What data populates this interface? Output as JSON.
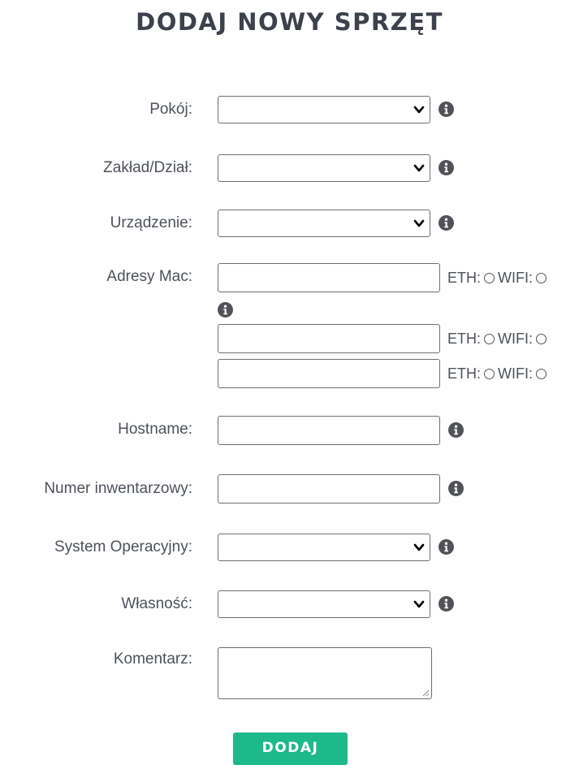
{
  "page": {
    "title": "DODAJ NOWY SPRZĘT"
  },
  "form": {
    "room": {
      "label": "Pokój:",
      "value": ""
    },
    "department": {
      "label": "Zakład/Dział:",
      "value": ""
    },
    "device": {
      "label": "Urządzenie:",
      "value": ""
    },
    "mac": {
      "label": "Adresy Mac:",
      "entries": [
        {
          "value": "",
          "eth_label": "ETH:",
          "wifi_label": "WIFI:"
        },
        {
          "value": "",
          "eth_label": "ETH:",
          "wifi_label": "WIFI:"
        },
        {
          "value": "",
          "eth_label": "ETH:",
          "wifi_label": "WIFI:"
        }
      ]
    },
    "hostname": {
      "label": "Hostname:",
      "value": ""
    },
    "inventory_number": {
      "label": "Numer inwentarzowy:",
      "value": ""
    },
    "os": {
      "label": "System Operacyjny:",
      "value": ""
    },
    "ownership": {
      "label": "Własność:",
      "value": ""
    },
    "comment": {
      "label": "Komentarz:",
      "value": ""
    },
    "submit_label": "DODAJ"
  },
  "icons": {
    "info": "info-circle-icon",
    "dropdown": "chevron-down-icon"
  },
  "colors": {
    "submit_bg": "#1eb98a",
    "info_icon": "#505050",
    "text": "#4d525a"
  }
}
